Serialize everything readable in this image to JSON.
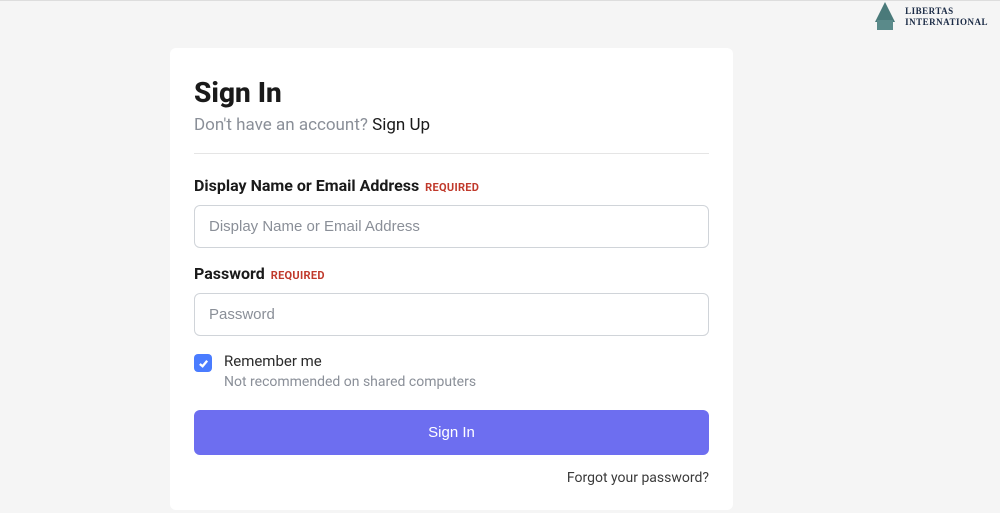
{
  "brand": {
    "name_line1": "LIBERTAS",
    "name_line2": "INTERNATIONAL"
  },
  "card": {
    "title": "Sign In",
    "sub_prompt": "Don't have an account? ",
    "signup_link": "Sign Up"
  },
  "fields": {
    "username": {
      "label": "Display Name or Email Address",
      "required_tag": "REQUIRED",
      "placeholder": "Display Name or Email Address",
      "value": ""
    },
    "password": {
      "label": "Password",
      "required_tag": "REQUIRED",
      "placeholder": "Password",
      "value": ""
    }
  },
  "remember": {
    "checked": true,
    "label": "Remember me",
    "hint": "Not recommended on shared computers"
  },
  "actions": {
    "submit": "Sign In",
    "forgot": "Forgot your password?"
  },
  "colors": {
    "accent_button": "#6d6ef0",
    "checkbox": "#4a7cff",
    "required": "#c0392b"
  }
}
